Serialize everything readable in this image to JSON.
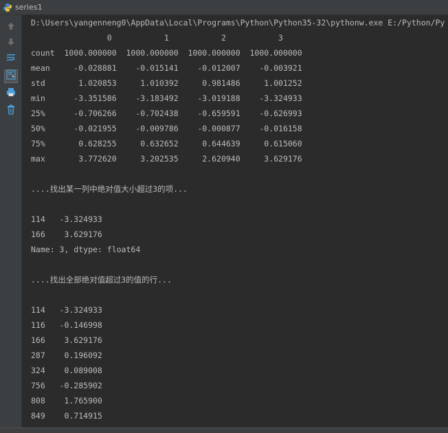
{
  "window": {
    "title": "series1"
  },
  "toolbar": {
    "buttons": [
      {
        "icon": "arrow-up-icon"
      },
      {
        "icon": "arrow-down-icon"
      },
      {
        "icon": "soft-wrap-icon"
      },
      {
        "icon": "scroll-to-end-icon"
      },
      {
        "icon": "print-icon"
      },
      {
        "icon": "trash-icon"
      }
    ]
  },
  "console": {
    "lines": [
      "D:\\Users\\yangenneng0\\AppData\\Local\\Programs\\Python\\Python35-32\\pythonw.exe E:/Python/Py",
      "                0           1           2           3",
      "count  1000.000000  1000.000000  1000.000000  1000.000000",
      "mean     -0.028881    -0.015141    -0.012007    -0.003921",
      "std       1.020853     1.010392     0.981486     1.001252",
      "min      -3.351586    -3.183492    -3.019188    -3.324933",
      "25%      -0.706266    -0.702438    -0.659591    -0.626993",
      "50%      -0.021955    -0.009786    -0.000877    -0.016158",
      "75%       0.628255     0.632652     0.644639     0.615060",
      "max       3.772620     3.202535     2.620940     3.629176",
      "",
      "....找出某一列中绝对值大小超过3的项...",
      "",
      "114   -3.324933",
      "166    3.629176",
      "Name: 3, dtype: float64",
      "",
      "....找出全部绝对值超过3的值的行...",
      "",
      "114   -3.324933",
      "116   -0.146998",
      "166    3.629176",
      "287    0.196092",
      "324    0.089008",
      "756   -0.285902",
      "808    1.765900",
      "849    0.714915"
    ]
  },
  "colors": {
    "background": "#2b2b2b",
    "panel": "#3c3f41",
    "text": "#bbbbbb",
    "icon_blue": "#4a9fd8"
  }
}
